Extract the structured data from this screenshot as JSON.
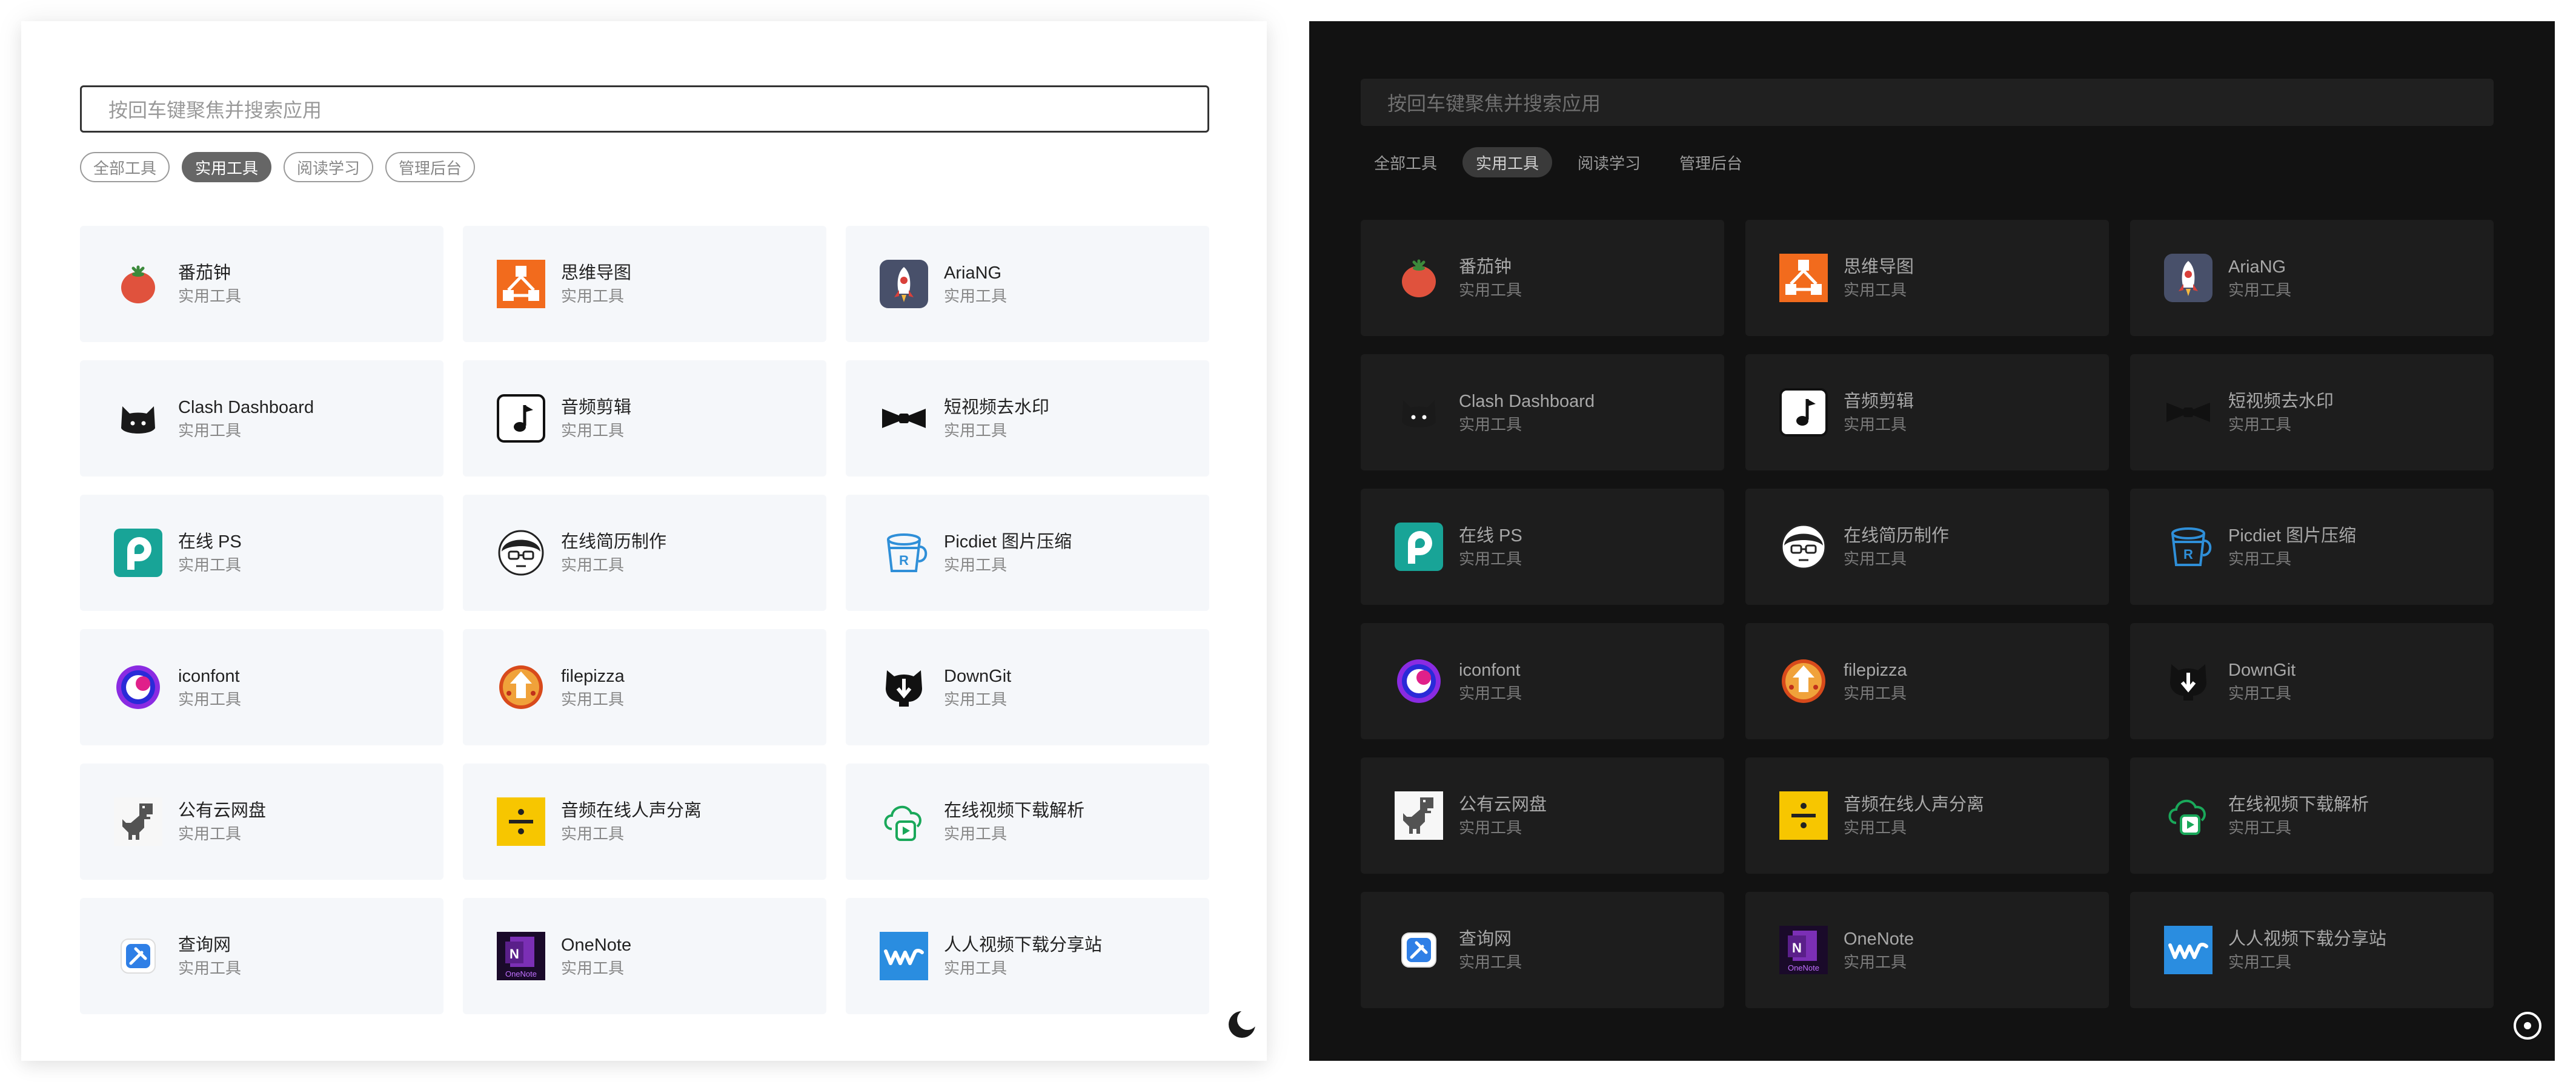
{
  "light": {
    "search": {
      "placeholder": "按回车键聚焦并搜索应用"
    },
    "tabs": [
      "全部工具",
      "实用工具",
      "阅读学习",
      "管理后台"
    ],
    "active_tab": "实用工具",
    "theme_toggle": "moon-icon"
  },
  "dark": {
    "search": {
      "placeholder": "按回车键聚焦并搜索应用"
    },
    "tabs": [
      "全部工具",
      "实用工具",
      "阅读学习",
      "管理后台"
    ],
    "active_tab": "实用工具",
    "theme_toggle": "sun-icon"
  },
  "apps": [
    {
      "name": "番茄钟",
      "category": "实用工具",
      "icon": "tomato-icon"
    },
    {
      "name": "思维导图",
      "category": "实用工具",
      "icon": "mindmap-icon"
    },
    {
      "name": "AriaNG",
      "category": "实用工具",
      "icon": "rocket-icon"
    },
    {
      "name": "Clash Dashboard",
      "category": "实用工具",
      "icon": "cat-icon"
    },
    {
      "name": "音频剪辑",
      "category": "实用工具",
      "icon": "music-note-icon"
    },
    {
      "name": "短视频去水印",
      "category": "实用工具",
      "icon": "bowtie-icon"
    },
    {
      "name": "在线 PS",
      "category": "实用工具",
      "icon": "photopea-icon"
    },
    {
      "name": "在线简历制作",
      "category": "实用工具",
      "icon": "avatar-glasses-icon"
    },
    {
      "name": "Picdiet 图片压缩",
      "category": "实用工具",
      "icon": "bucket-icon"
    },
    {
      "name": "iconfont",
      "category": "实用工具",
      "icon": "iconfont-icon"
    },
    {
      "name": "filepizza",
      "category": "实用工具",
      "icon": "pizza-icon"
    },
    {
      "name": "DownGit",
      "category": "实用工具",
      "icon": "github-download-icon"
    },
    {
      "name": "公有云网盘",
      "category": "实用工具",
      "icon": "dinosaur-icon"
    },
    {
      "name": "音频在线人声分离",
      "category": "实用工具",
      "icon": "divide-icon"
    },
    {
      "name": "在线视频下载解析",
      "category": "实用工具",
      "icon": "cloud-video-icon"
    },
    {
      "name": "查询网",
      "category": "实用工具",
      "icon": "tools-icon"
    },
    {
      "name": "OneNote",
      "category": "实用工具",
      "icon": "onenote-icon"
    },
    {
      "name": "人人视频下载分享站",
      "category": "实用工具",
      "icon": "wave-logo-icon"
    }
  ]
}
